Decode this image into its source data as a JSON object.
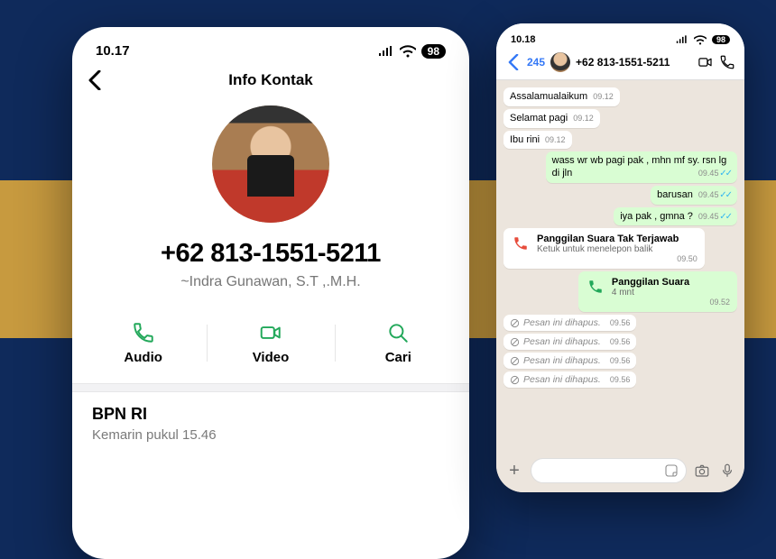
{
  "colors": {
    "accent": "#25d366",
    "link": "#34b7f1"
  },
  "left": {
    "status": {
      "time": "10.17",
      "battery": "98"
    },
    "nav_title": "Info Kontak",
    "phone": "+62 813-1551-5211",
    "name": "~Indra Gunawan, S.T ,.M.H.",
    "actions": {
      "audio": "Audio",
      "video": "Video",
      "search": "Cari"
    },
    "group": {
      "title": "BPN RI",
      "subtitle": "Kemarin pukul 15.46"
    }
  },
  "right": {
    "status": {
      "time": "10.18",
      "battery": "98"
    },
    "header": {
      "unread": "245",
      "title": "+62 813-1551-5211"
    },
    "messages": [
      {
        "side": "left",
        "text": "Assalamualaikum",
        "time": "09.12"
      },
      {
        "side": "left",
        "text": "Selamat pagi",
        "time": "09.12"
      },
      {
        "side": "left",
        "text": "Ibu rini",
        "time": "09.12"
      },
      {
        "side": "right",
        "text": "wass wr wb pagi pak , mhn mf sy. rsn lg di jln",
        "time": "09.45"
      },
      {
        "side": "right",
        "text": "barusan",
        "time": "09.45"
      },
      {
        "side": "right",
        "text": "iya pak , gmna ?",
        "time": "09.45"
      }
    ],
    "missed_call": {
      "title": "Panggilan Suara Tak Terjawab",
      "sub": "Ketuk untuk menelepon balik",
      "time": "09.50"
    },
    "outgoing_call": {
      "title": "Panggilan Suara",
      "sub": "4 mnt",
      "time": "09.52"
    },
    "deleted": [
      {
        "text": "Pesan ini dihapus.",
        "time": "09.56"
      },
      {
        "text": "Pesan ini dihapus.",
        "time": "09.56"
      },
      {
        "text": "Pesan ini dihapus.",
        "time": "09.56"
      },
      {
        "text": "Pesan ini dihapus.",
        "time": "09.56"
      }
    ],
    "input_placeholder": ""
  }
}
